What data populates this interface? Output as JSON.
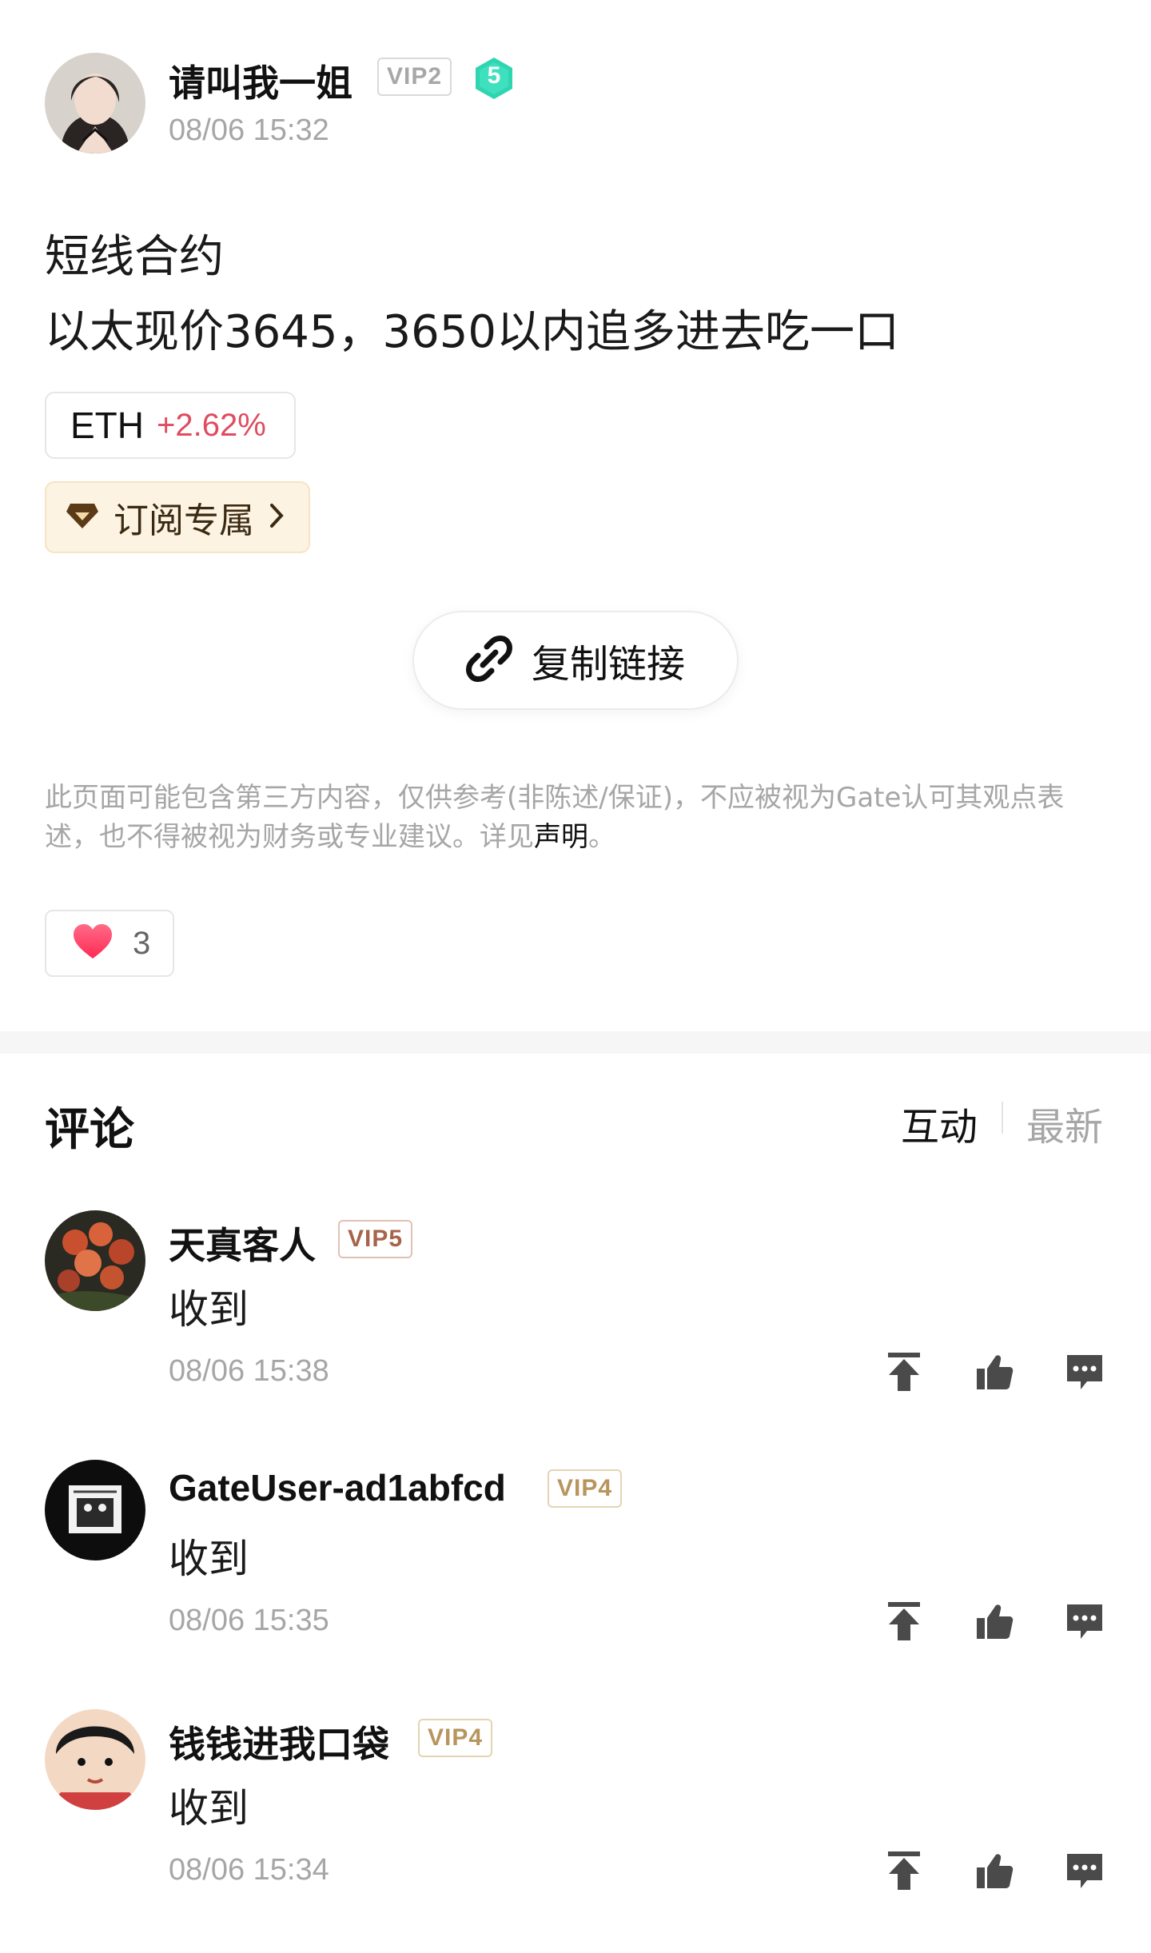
{
  "post": {
    "author": {
      "name": "请叫我一姐",
      "vip": "VIP2",
      "level": "5",
      "time": "08/06 15:32"
    },
    "lines": [
      "短线合约",
      "以太现价3645，3650以内追多进去吃一口"
    ],
    "coin": {
      "symbol": "ETH",
      "change": "+2.62%"
    },
    "subscription_label": "订阅专属",
    "copy_link_label": "复制链接",
    "disclaimer": {
      "text": "此页面可能包含第三方内容，仅供参考(非陈述/保证)，不应被视为Gate认可其观点表述，也不得被视为财务或专业建议。详见",
      "link": "声明",
      "end": "。"
    },
    "likes": "3"
  },
  "comments_section": {
    "title": "评论",
    "sort": {
      "active": "互动",
      "inactive": "最新"
    },
    "items": [
      {
        "name": "天真客人",
        "vip": "VIP5",
        "text": "收到",
        "time": "08/06 15:38"
      },
      {
        "name": "GateUser-ad1abfcd",
        "vip": "VIP4",
        "text": "收到",
        "time": "08/06 15:35"
      },
      {
        "name": "钱钱进我口袋",
        "vip": "VIP4",
        "text": "收到",
        "time": "08/06 15:34"
      }
    ]
  },
  "colors": {
    "price_up": "#e04b5f",
    "level_badge": "#2fd4b0",
    "vip_gold": "#b8955d",
    "vip_bronze": "#a8644a",
    "like_heart": "#ff3d63"
  },
  "icons": [
    "link-icon",
    "diamond-icon",
    "chevron-right-icon",
    "heart-icon",
    "pin-top-icon",
    "thumb-up-icon",
    "comment-icon"
  ]
}
